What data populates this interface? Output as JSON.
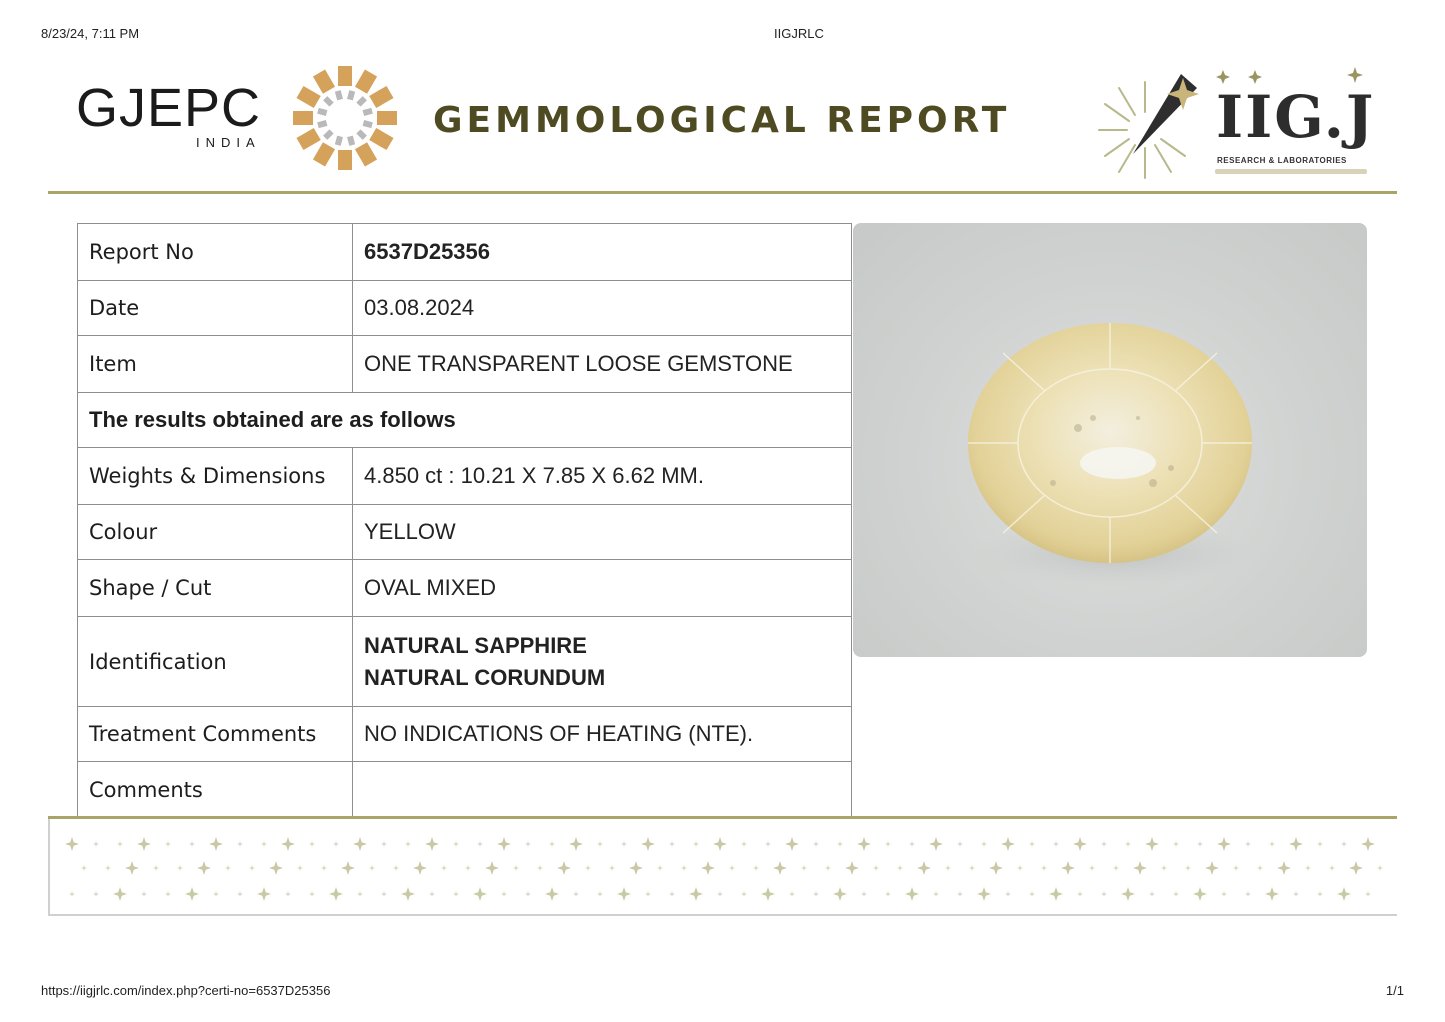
{
  "browser": {
    "datetime": "8/23/24, 7:11 PM",
    "tab_title": "IIGJRLC",
    "url": "https://iigjrlc.com/index.php?certi-no=6537D25356",
    "page_indicator": "1/1"
  },
  "header": {
    "gjepc_logo_text": "GJEPC",
    "gjepc_logo_sub": "INDIA",
    "title": "GEMMOLOGICAL REPORT",
    "iigj_logo_text": "IIG.J",
    "iigj_logo_sub": "RESEARCH & LABORATORIES",
    "accent_color": "#4e4b22",
    "rule_color": "#a9a46a"
  },
  "report": {
    "rows": [
      {
        "label": "Report No",
        "value": "6537D25356"
      },
      {
        "label": "Date",
        "value": "03.08.2024"
      },
      {
        "label": "Item",
        "value": "ONE TRANSPARENT LOOSE GEMSTONE"
      },
      {
        "section_heading": "The results obtained are as follows"
      },
      {
        "label": "Weights & Dimensions",
        "value": "4.850 ct : 10.21 X 7.85 X 6.62 MM."
      },
      {
        "label": "Colour",
        "value": "YELLOW"
      },
      {
        "label": "Shape / Cut",
        "value": "OVAL MIXED"
      },
      {
        "label": "Identification",
        "value_lines": [
          "NATURAL SAPPHIRE",
          "NATURAL CORUNDUM"
        ]
      },
      {
        "label": "Treatment Comments",
        "value": "NO INDICATIONS OF HEATING (NTE)."
      },
      {
        "label": "Comments",
        "value": ""
      }
    ]
  },
  "gem_image": {
    "icon": "oval-yellow-sapphire-photo"
  }
}
